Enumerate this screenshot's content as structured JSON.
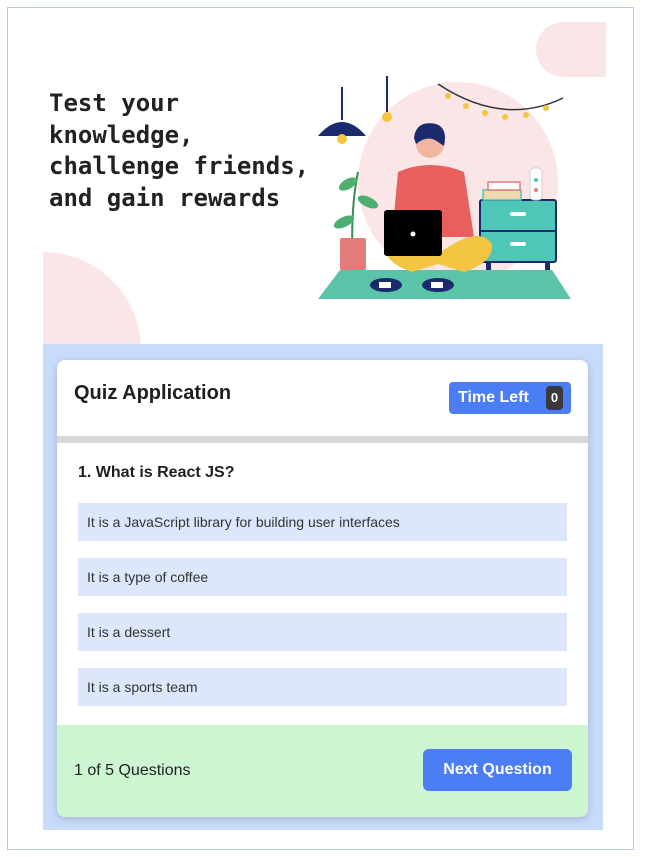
{
  "hero": {
    "tagline": "Test your\nknowledge,\nchallenge friends,\nand gain rewards"
  },
  "quiz": {
    "title": "Quiz Application",
    "timer": {
      "label": "Time Left",
      "value": "0"
    },
    "question": "1. What is React JS?",
    "options": [
      "It is a JavaScript library for building user interfaces",
      "It is a type of coffee",
      "It is a dessert",
      "It is a sports team"
    ],
    "progress": "1 of 5 Questions",
    "next_label": "Next Question"
  },
  "colors": {
    "accent": "#4b7ef5",
    "option_bg": "#dde7fb",
    "footer_bg": "#cdf5d2",
    "panel_bg": "#c9dbfb",
    "blob": "#fbe6e7"
  }
}
